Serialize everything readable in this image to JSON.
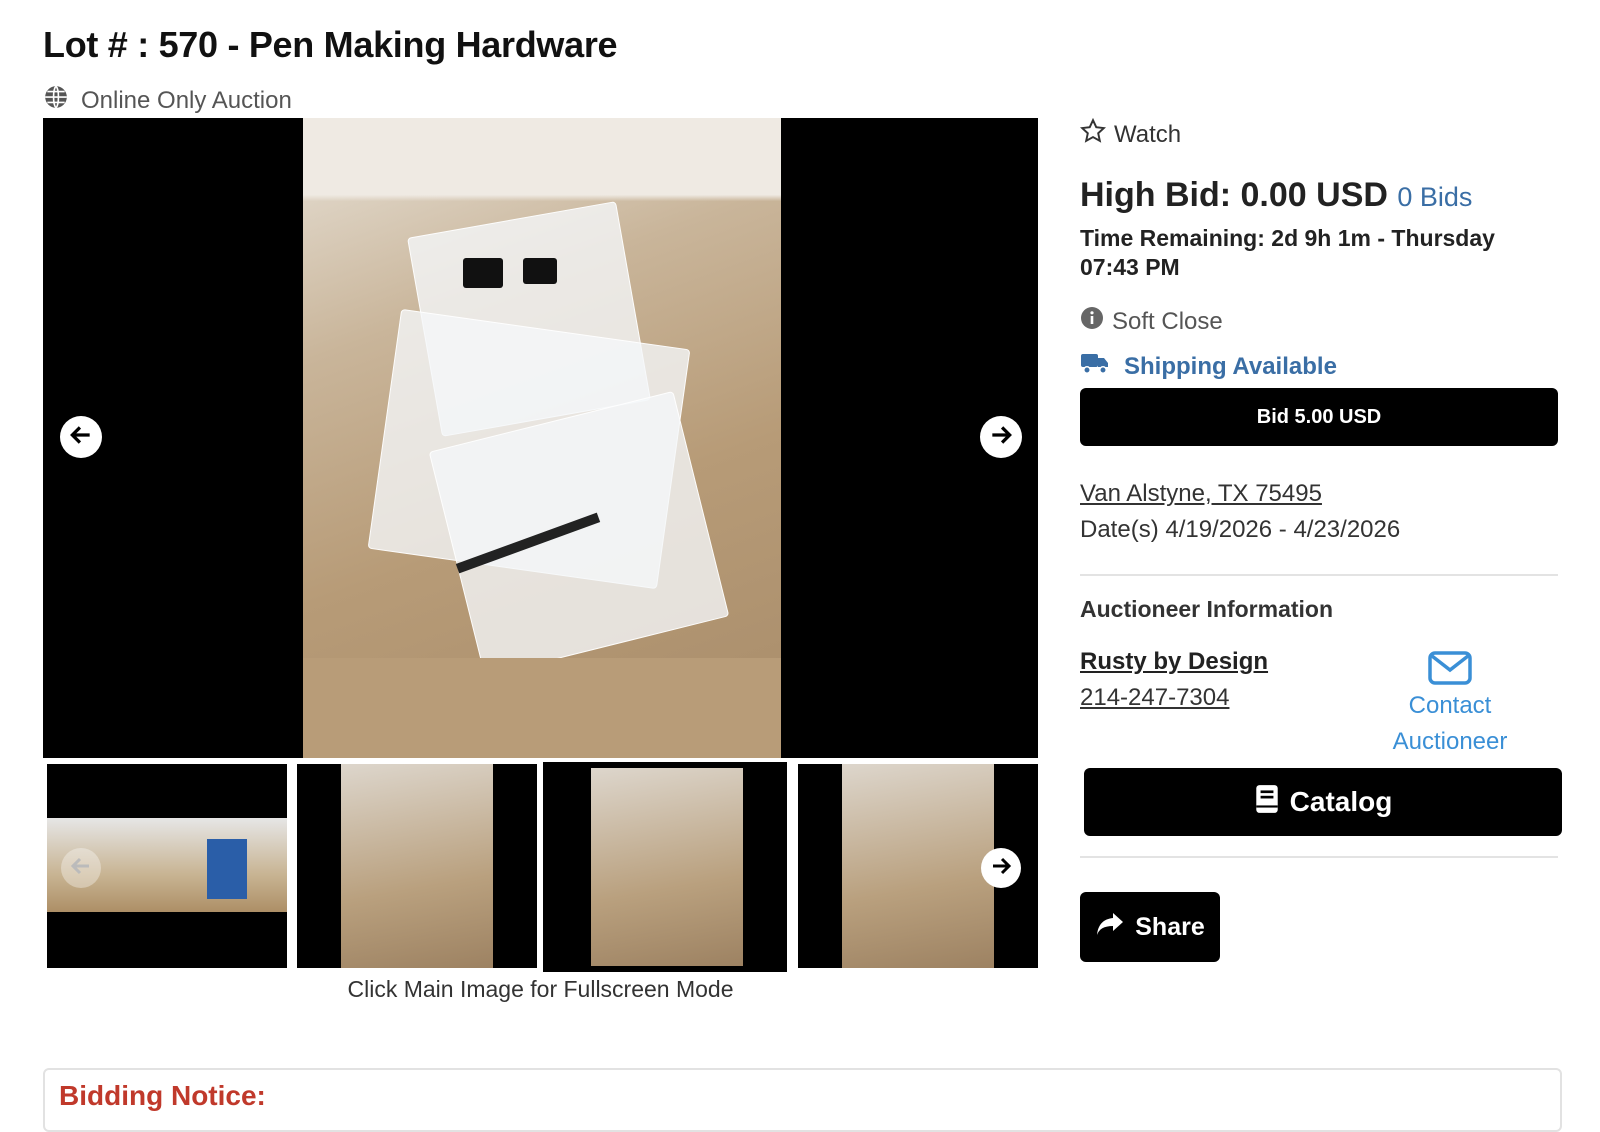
{
  "lot": {
    "title": "Lot # : 570 - Pen Making Hardware",
    "auction_type": "Online Only Auction"
  },
  "gallery": {
    "caption": "Click Main Image for Fullscreen Mode",
    "thumbnail_count": 4,
    "selected_thumbnail": 3
  },
  "bidding": {
    "watch_label": "Watch",
    "high_bid_label": "High Bid: 0.00 USD",
    "bids_label": "0 Bids",
    "time_remaining": "Time Remaining: 2d 9h 1m - Thursday 07:43 PM",
    "soft_close": "Soft Close",
    "shipping": "Shipping Available",
    "bid_button": "Bid 5.00 USD"
  },
  "location": {
    "address": "Van Alstyne, TX 75495",
    "dates": "Date(s) 4/19/2026 - 4/23/2026"
  },
  "auctioneer": {
    "heading": "Auctioneer Information",
    "name": "Rusty by Design",
    "phone": "214-247-7304",
    "contact_label": "Contact Auctioneer"
  },
  "actions": {
    "catalog_label": "Catalog",
    "share_label": "Share"
  },
  "notice": {
    "heading": "Bidding Notice:"
  },
  "colors": {
    "link_blue": "#3a6ea5",
    "contact_blue": "#3a8fd6",
    "notice_red": "#c0392b"
  }
}
